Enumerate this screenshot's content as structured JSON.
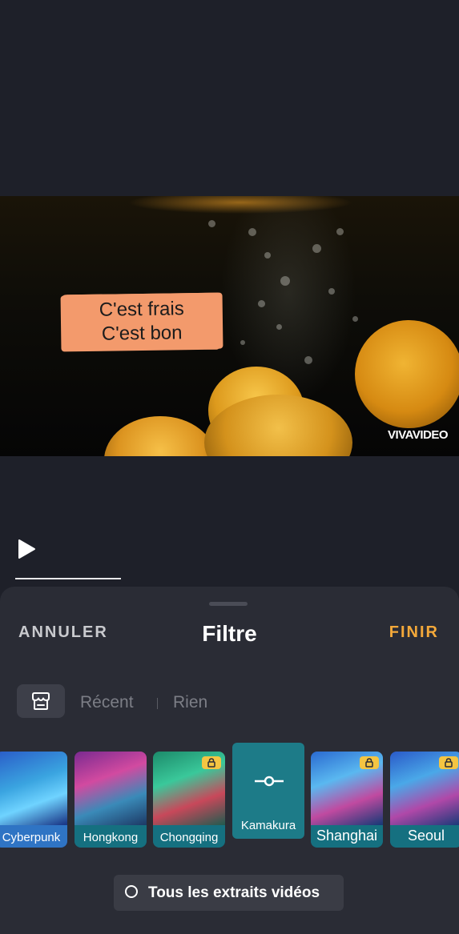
{
  "video": {
    "caption_line1": "C'est  frais",
    "caption_line2": "C'est bon",
    "watermark": "VIVAVIDEO"
  },
  "player": {
    "play_icon": "play-icon",
    "progress_fraction": 0.23
  },
  "sheet": {
    "cancel_label": "ANNULER",
    "title": "Filtre",
    "finish_label": "FINIR",
    "store_icon": "store-icon",
    "tabs": [
      "Récent",
      "Rien"
    ],
    "filters": [
      {
        "name": "Cyberpunk",
        "locked": false
      },
      {
        "name": "Hongkong",
        "locked": false
      },
      {
        "name": "Chongqing",
        "locked": true
      },
      {
        "name": "Kamakura",
        "locked": false,
        "selected": true
      },
      {
        "name": "Shanghai",
        "locked": true
      },
      {
        "name": "Seoul",
        "locked": true
      }
    ],
    "apply_all_label": "Tous les extraits vidéos"
  },
  "colors": {
    "background": "#1e2029",
    "sheet": "#2a2c35",
    "accent": "#f4a93a",
    "filter_label_bg": "#157080",
    "lock_badge": "#f4c542"
  }
}
